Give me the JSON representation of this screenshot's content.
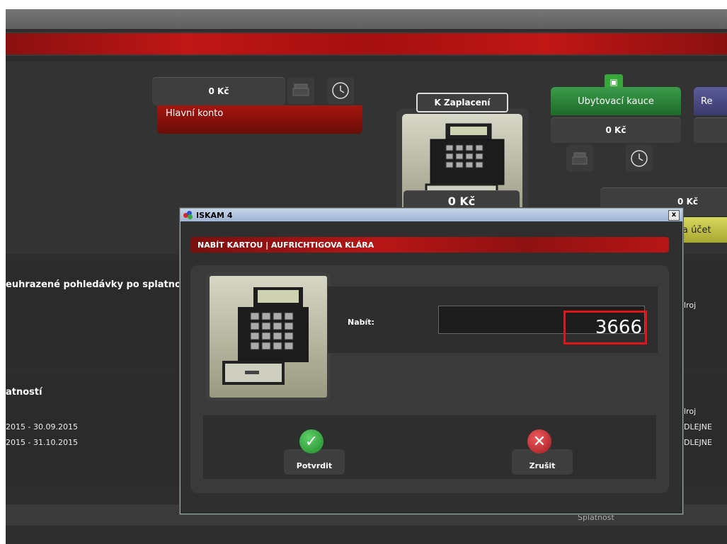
{
  "dashboard": {
    "main_account_amount": "0 Kč",
    "main_account_label": "Hlavní konto",
    "to_pay_label": "K Zaplacení",
    "to_pay_amount": "0 Kč",
    "deposit_label": "Ubytovací kauce",
    "deposit_amount": "0 Kč",
    "blue_label_partial": "Re",
    "right_amount": "0 Kč",
    "yellow_partial": "a účet"
  },
  "background": {
    "unpaid_title": "euhrazené pohledávky po splatnost",
    "zdroj_1": "lroj",
    "section2_title": "atností",
    "zdroj_2": "lroj",
    "rows": [
      {
        "period": "2015 - 30.09.2015",
        "source": "DLEJNE"
      },
      {
        "period": "2015 - 31.10.2015",
        "source": "DLEJNE"
      }
    ],
    "splatnost": "Splatnost"
  },
  "dialog": {
    "title": "ISKAM 4",
    "close": "x",
    "header": "NABÍT KARTOU | AUFRICHTIGOVA KLÁRA",
    "charge_label": "Nabít:",
    "charge_value": "3666",
    "confirm_label": "Potvrdit",
    "cancel_label": "Zrušit"
  },
  "colors": {
    "accent_red": "#c01616",
    "confirm_green": "#2fa53a",
    "cancel_red": "#c9262b",
    "highlight_box": "#e0141a"
  }
}
